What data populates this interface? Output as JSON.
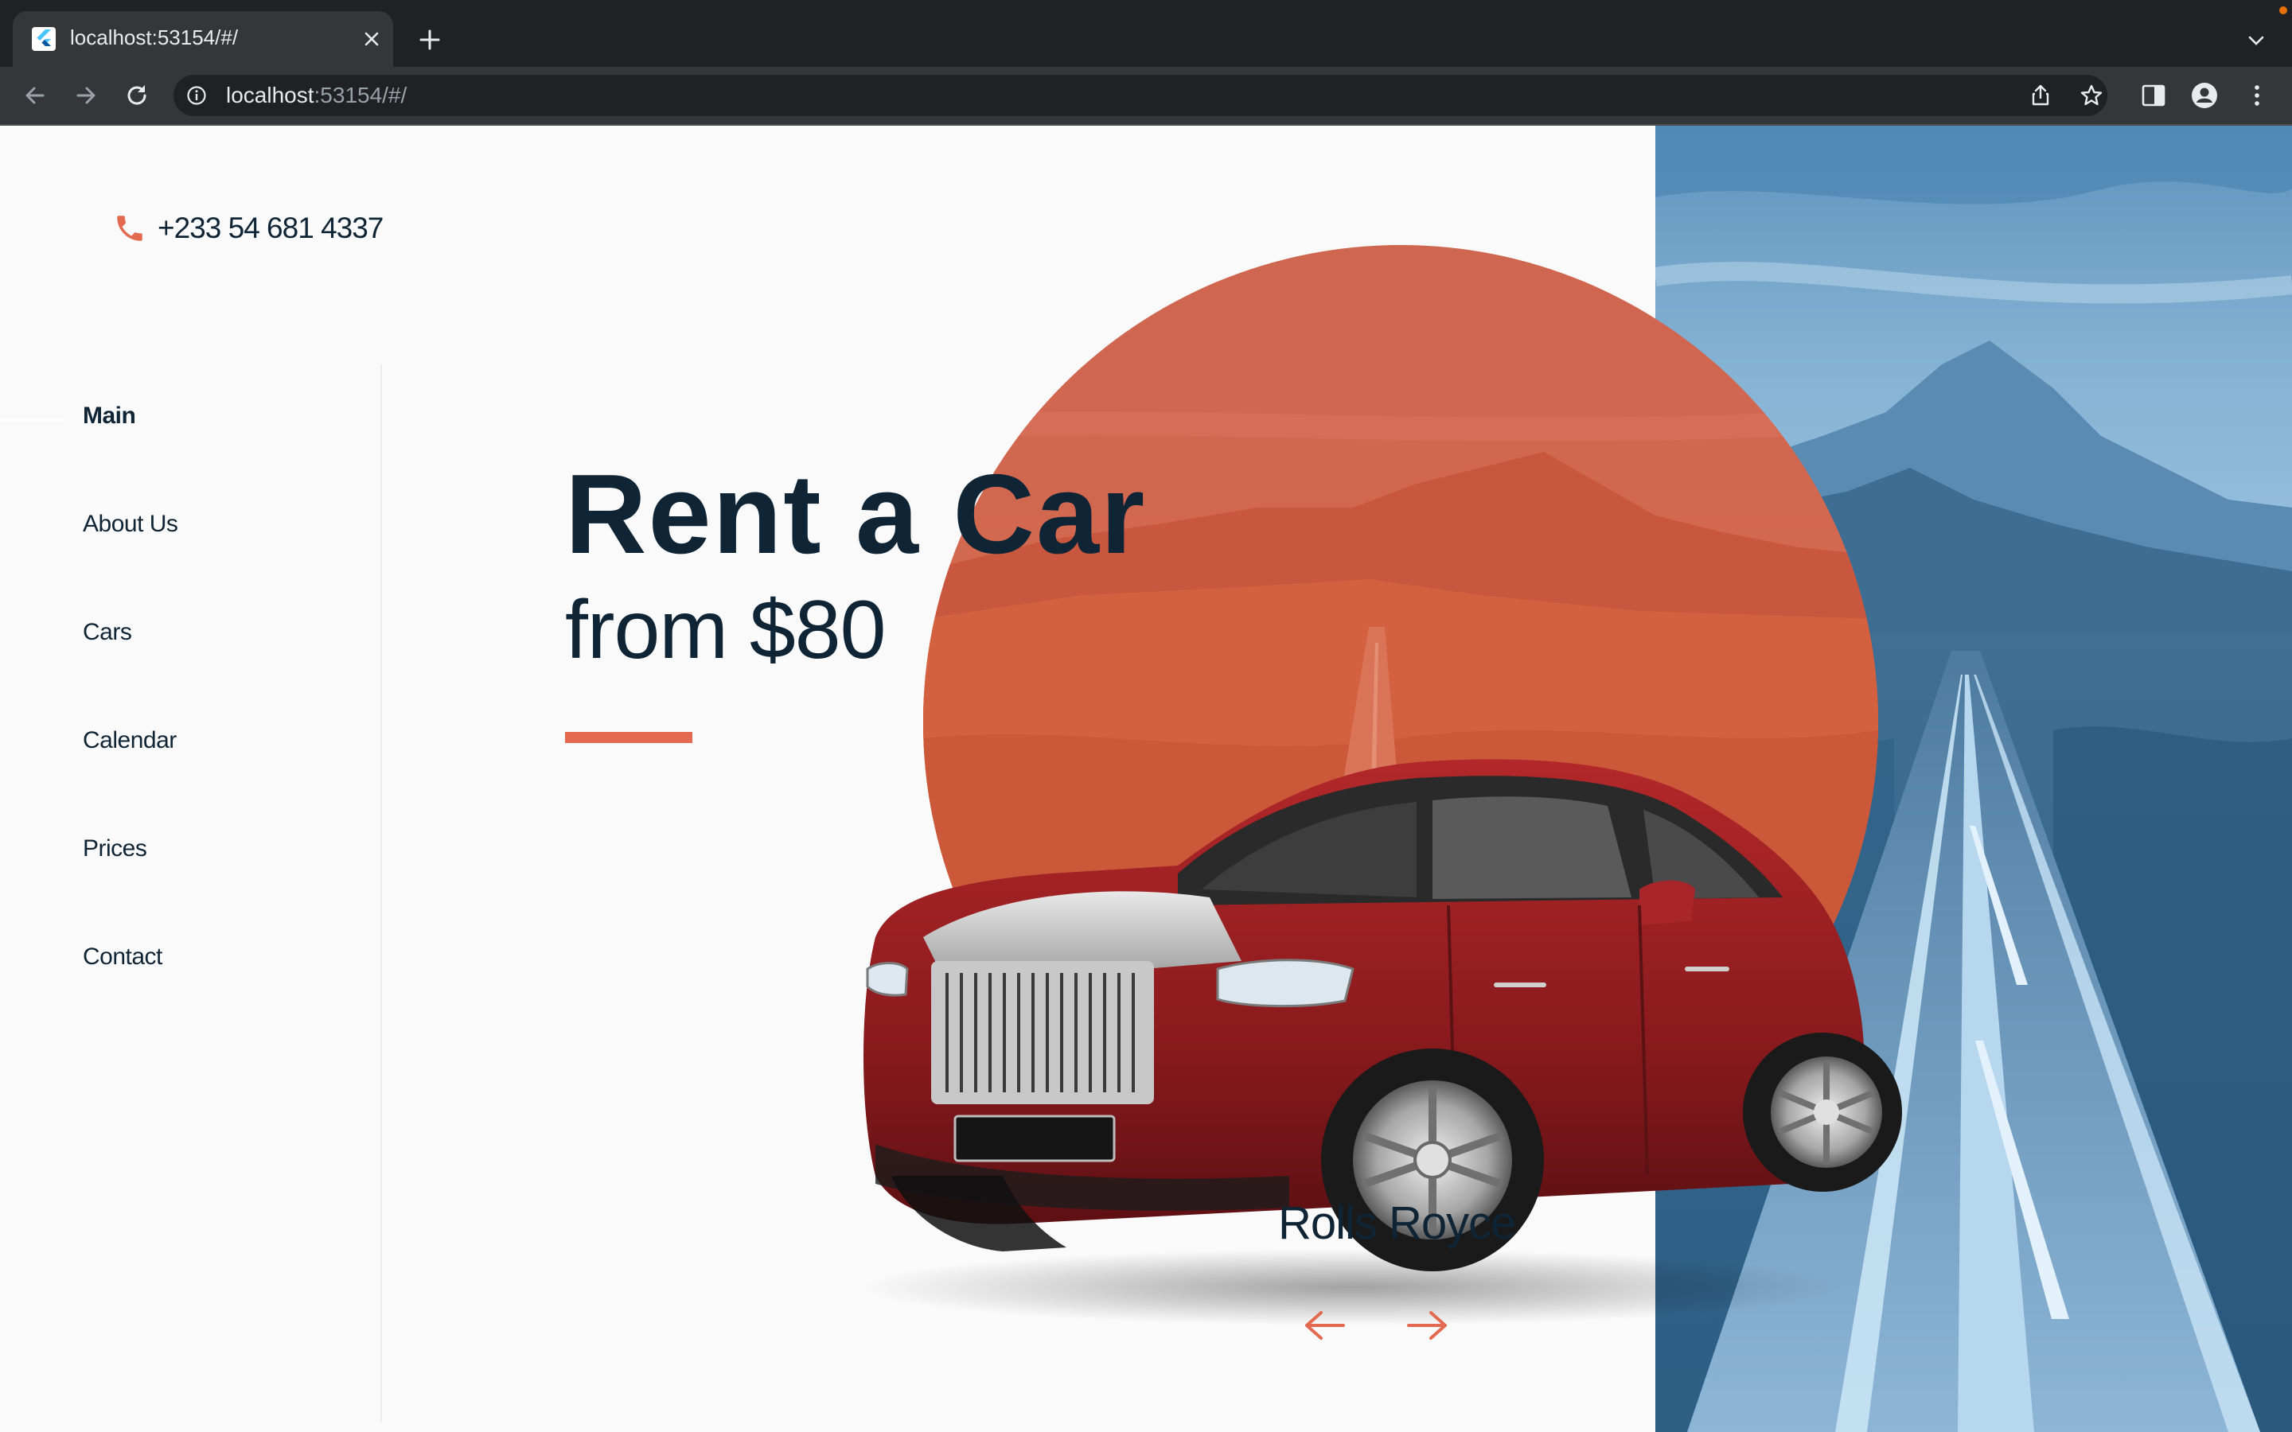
{
  "browser": {
    "tab_title": "localhost:53154/#/",
    "url_host": "localhost",
    "url_rest": ":53154/#/"
  },
  "header": {
    "phone": "+233 54 681 4337"
  },
  "nav": {
    "items": [
      {
        "label": "Main",
        "active": true
      },
      {
        "label": "About Us",
        "active": false
      },
      {
        "label": "Cars",
        "active": false
      },
      {
        "label": "Calendar",
        "active": false
      },
      {
        "label": "Prices",
        "active": false
      },
      {
        "label": "Contact",
        "active": false
      }
    ]
  },
  "hero": {
    "title": "Rent a Car",
    "subtitle": "from $80"
  },
  "car": {
    "name": "Rolls Royce"
  },
  "colors": {
    "accent": "#e36a50",
    "text": "#0f2536",
    "background": "#fafafa",
    "road_tint": "#3f7aa6"
  },
  "icons": {
    "phone": "phone-icon",
    "prev": "arrow-left-icon",
    "next": "arrow-right-icon"
  }
}
